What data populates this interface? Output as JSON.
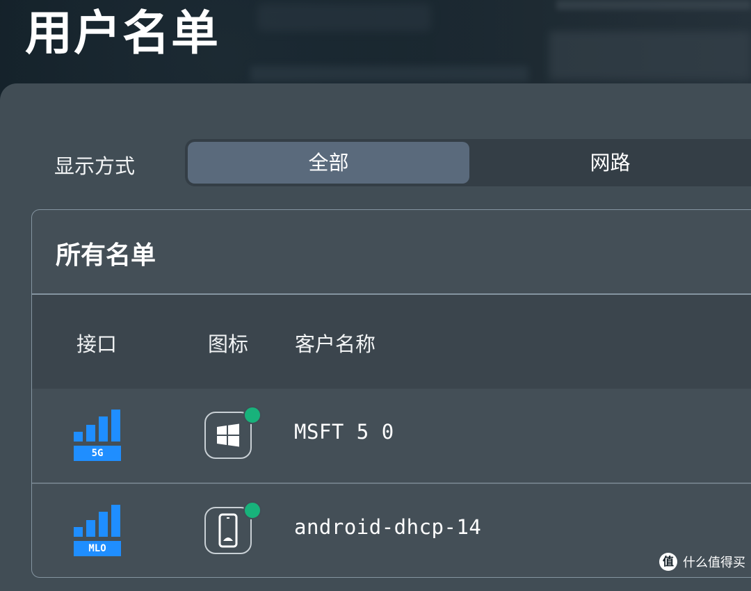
{
  "page": {
    "title": "用户名单"
  },
  "view_mode": {
    "label": "显示方式",
    "options": [
      {
        "label": "全部",
        "selected": true
      },
      {
        "label": "网路",
        "selected": false
      }
    ]
  },
  "client_list": {
    "title": "所有名单",
    "columns": {
      "interface": "接口",
      "icon": "图标",
      "name": "客户名称"
    },
    "rows": [
      {
        "interface_badge": "5G",
        "signal_level": 4,
        "device_icon": "windows-icon",
        "online": true,
        "name": "MSFT 5 0"
      },
      {
        "interface_badge": "MLO",
        "signal_level": 4,
        "device_icon": "android-phone-icon",
        "online": true,
        "name": "android-dhcp-14"
      }
    ]
  },
  "watermark": {
    "logo": "值",
    "text": "什么值得买"
  },
  "colors": {
    "signal": "#1f8eff",
    "online": "#18b27b",
    "selected_segment": "#5a6a7c"
  }
}
